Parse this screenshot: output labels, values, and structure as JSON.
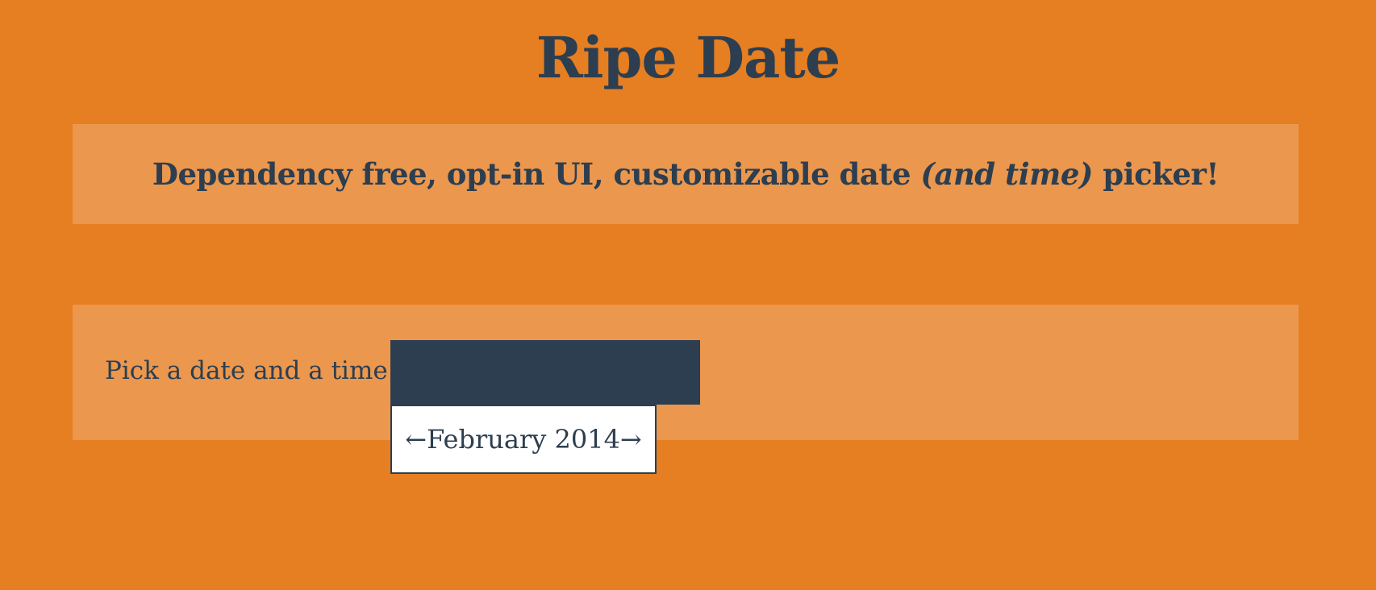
{
  "header": {
    "title": "Ripe Date"
  },
  "tagline": {
    "text_before": "Dependency free, opt-in UI, customizable date ",
    "emphasis": "(and time)",
    "text_after": " picker!"
  },
  "demo": {
    "label": "Pick a date and a time:",
    "input_value": ""
  },
  "datepicker": {
    "prev_arrow": "←",
    "month_year": "February 2014",
    "next_arrow": "→"
  },
  "colors": {
    "background": "#e67e22",
    "panel": "rgba(255,255,255,0.2)",
    "text": "#2c3e50",
    "input_bg": "#2c3e50",
    "popup_bg": "#ffffff"
  }
}
